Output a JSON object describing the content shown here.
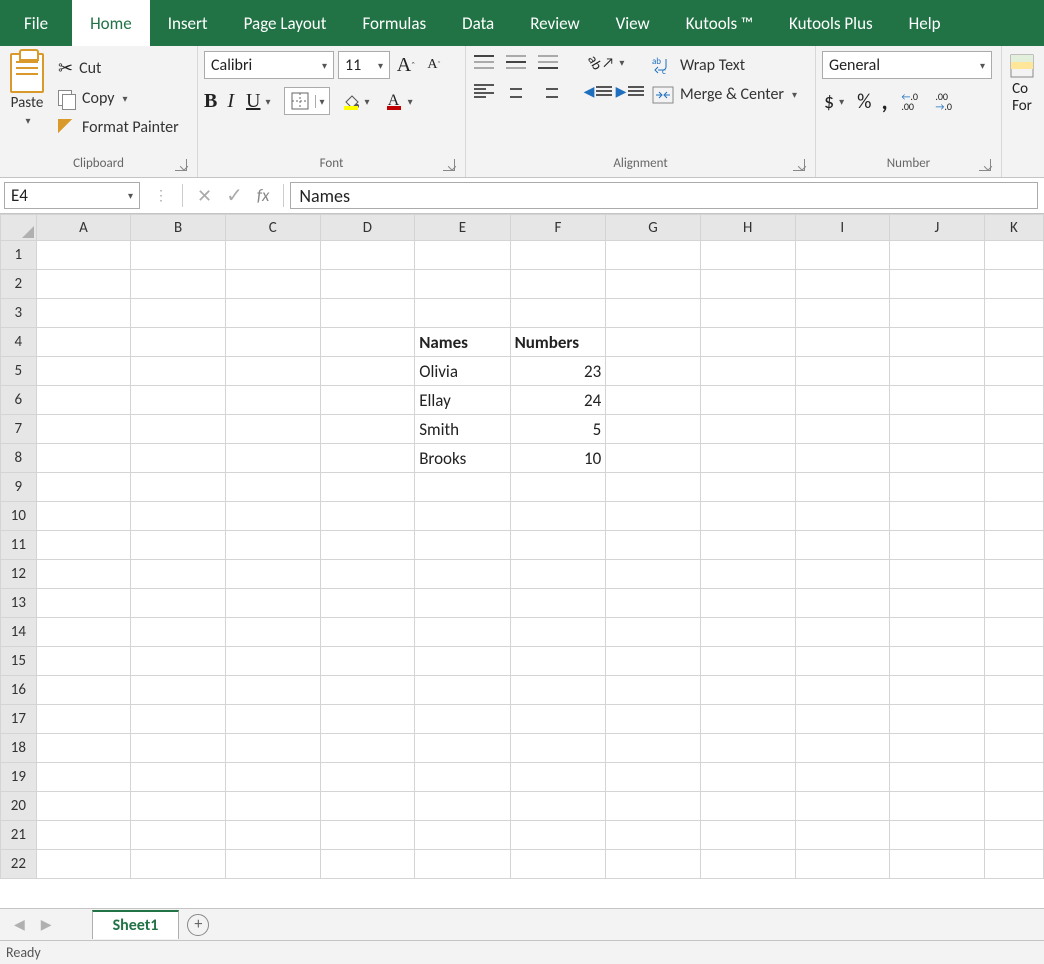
{
  "tabs": {
    "file": "File",
    "home": "Home",
    "insert": "Insert",
    "page_layout": "Page Layout",
    "formulas": "Formulas",
    "data": "Data",
    "review": "Review",
    "view": "View",
    "kutools": "Kutools ™",
    "kutools_plus": "Kutools Plus",
    "help": "Help"
  },
  "ribbon": {
    "clipboard": {
      "paste": "Paste",
      "cut": "Cut",
      "copy": "Copy",
      "format_painter": "Format Painter",
      "label": "Clipboard"
    },
    "font": {
      "name": "Calibri",
      "size": "11",
      "label": "Font",
      "bold": "B",
      "italic": "I",
      "underline": "U",
      "grow": "A",
      "shrink": "A"
    },
    "alignment": {
      "wrap": "Wrap Text",
      "merge": "Merge & Center",
      "label": "Alignment"
    },
    "number": {
      "format": "General",
      "currency": "$",
      "percent": "%",
      "comma": ",",
      "inc": ".0\n.00",
      "dec": ".00\n.0",
      "label": "Number"
    },
    "cond": {
      "label_top": "Co",
      "label_bot": "For"
    }
  },
  "formula_bar": {
    "name_box": "E4",
    "fx": "fx",
    "value": "Names"
  },
  "grid": {
    "columns": [
      "A",
      "B",
      "C",
      "D",
      "E",
      "F",
      "G",
      "H",
      "I",
      "J",
      "K"
    ],
    "row_count": 22,
    "cells": {
      "E4": {
        "v": "Names",
        "bold": true,
        "align": "left"
      },
      "F4": {
        "v": "Numbers",
        "bold": true,
        "align": "left"
      },
      "E5": {
        "v": "Olivia",
        "align": "left"
      },
      "F5": {
        "v": "23",
        "align": "right"
      },
      "E6": {
        "v": "Ellay",
        "align": "left"
      },
      "F6": {
        "v": "24",
        "align": "right"
      },
      "E7": {
        "v": "Smith",
        "align": "left"
      },
      "F7": {
        "v": "5",
        "align": "right"
      },
      "E8": {
        "v": "Brooks",
        "align": "left"
      },
      "F8": {
        "v": "10",
        "align": "right"
      }
    }
  },
  "sheetbar": {
    "sheet1": "Sheet1"
  },
  "status": {
    "ready": "Ready"
  }
}
